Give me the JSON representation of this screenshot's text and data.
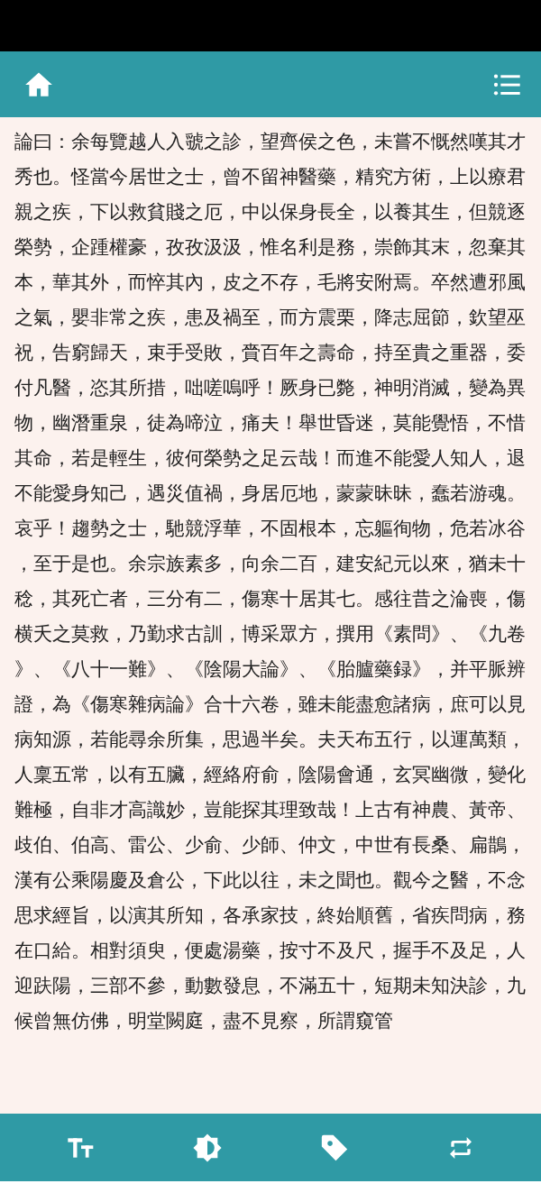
{
  "article": {
    "text": "論曰：余每覽越人入虢之診，望齊侯之色，未嘗不慨然嘆其才秀也。怪當今居世之士，曾不留神醫藥，精究方術，上以療君親之疾，下以救貧賤之厄，中以保身長全，以養其生，但競逐榮勢，企踵權豪，孜孜汲汲，惟名利是務，崇飾其末，忽棄其本，華其外，而悴其內，皮之不存，毛將安附焉。卒然遭邪風之氣，嬰非常之疾，患及禍至，而方震栗，降志屈節，欽望巫祝，告窮歸天，束手受敗，賫百年之壽命，持至貴之重器，委付凡醫，恣其所措，咄嗟嗚呼！厥身已斃，神明消滅，變為異物，幽潛重泉，徒為啼泣，痛夫！舉世昏迷，莫能覺悟，不惜其命，若是輕生，彼何榮勢之足云哉！而進不能愛人知人，退不能愛身知己，遇災值禍，身居厄地，蒙蒙昧昧，蠢若游魂。哀乎！趨勢之士，馳競浮華，不固根本，忘軀徇物，危若冰谷，至于是也。余宗族素多，向余二百，建安紀元以來，猶未十稔，其死亡者，三分有二，傷寒十居其七。感往昔之淪喪，傷横夭之莫救，乃勤求古訓，博采眾方，撰用《素問》、《九卷》、《八十一難》、《陰陽大論》、《胎臚藥録》，并平脈辨證，為《傷寒雜病論》合十六卷，雖未能盡愈諸病，庶可以見病知源，若能尋余所集，思過半矣。夫天布五行，以運萬類，人稟五常，以有五臟，經絡府俞，陰陽會通，玄冥幽微，變化難極，自非才高識妙，豈能探其理致哉！上古有神農、黃帝、歧伯、伯高、雷公、少俞、少師、仲文，中世有長桑、扁鵲，漢有公乘陽慶及倉公，下此以往，未之聞也。觀今之醫，不念思求經旨，以演其所知，各承家技，終始順舊，省疾問病，務在口給。相對須臾，便處湯藥，按寸不及尺，握手不及足，人迎趺陽，三部不參，動數發息，不滿五十，短期未知決診，九候曾無仿佛，明堂闕庭，盡不見察，所謂窺管"
  }
}
